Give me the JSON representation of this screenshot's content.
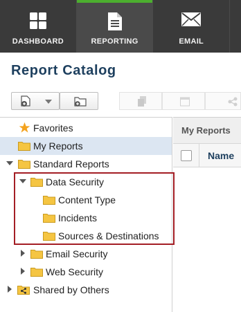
{
  "nav": {
    "items": [
      {
        "label": "DASHBOARD",
        "icon": "dashboard-grid-icon"
      },
      {
        "label": "REPORTING",
        "icon": "report-document-icon",
        "active": true
      },
      {
        "label": "EMAIL",
        "icon": "envelope-icon"
      }
    ],
    "active_accent": "#4caf2f"
  },
  "page": {
    "title": "Report Catalog"
  },
  "toolbar": {
    "buttons": [
      "new-report-icon",
      "dropdown-caret-icon",
      "new-folder-icon",
      "copy-icon",
      "schedule-calendar-icon",
      "share-icon"
    ]
  },
  "tree": {
    "favorites": "Favorites",
    "my_reports": "My Reports",
    "standard_reports": "Standard Reports",
    "data_security": "Data Security",
    "content_type": "Content Type",
    "incidents": "Incidents",
    "sources_destinations": "Sources & Destinations",
    "email_security": "Email Security",
    "web_security": "Web Security",
    "shared_by_others": "Shared by Others"
  },
  "right_pane": {
    "header": "My Reports",
    "column_name": "Name"
  },
  "colors": {
    "highlight_border": "#a31d24",
    "selected_row": "#dce6f2",
    "folder": "#f5c542"
  }
}
